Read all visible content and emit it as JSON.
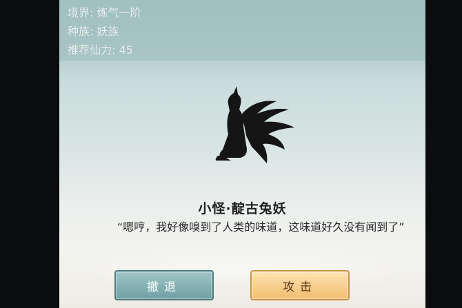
{
  "info": {
    "realm": "境界: 练气一阶",
    "race": "种族: 妖族",
    "power": "推荐仙力: 45"
  },
  "monster": {
    "name": "小怪·靛古兔妖",
    "dialogue": "“嗯哼，我好像嗅到了人类的味道，这味道好久没有闻到了”"
  },
  "buttons": {
    "retreat": "撤退",
    "attack": "攻击"
  }
}
